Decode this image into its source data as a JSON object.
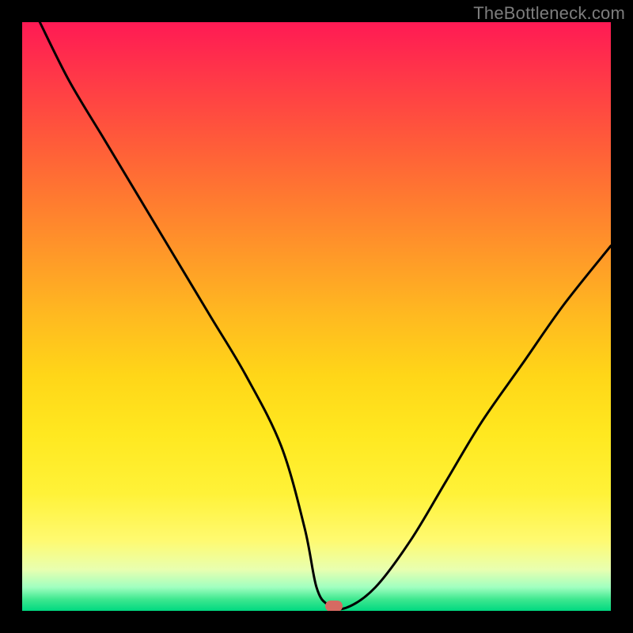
{
  "watermark": "TheBottleneck.com",
  "chart_data": {
    "type": "line",
    "title": "",
    "xlabel": "",
    "ylabel": "",
    "xlim": [
      0,
      100
    ],
    "ylim": [
      0,
      100
    ],
    "grid": false,
    "legend": false,
    "marker": {
      "x": 53,
      "y": 0,
      "color": "#d66a62"
    },
    "series": [
      {
        "name": "curve",
        "color": "#000000",
        "x": [
          3,
          8,
          14,
          20,
          26,
          32,
          38,
          44,
          48,
          50,
          52,
          55,
          60,
          66,
          72,
          78,
          85,
          92,
          100
        ],
        "y": [
          100,
          90,
          80,
          70,
          60,
          50,
          40,
          28,
          14,
          4,
          1,
          0.5,
          4,
          12,
          22,
          32,
          42,
          52,
          62
        ]
      }
    ],
    "background_gradient": {
      "top": "#ff1a54",
      "bottom": "#00d880"
    }
  },
  "layout": {
    "image_size": 800,
    "border_px": 28,
    "plot_size": 744
  }
}
